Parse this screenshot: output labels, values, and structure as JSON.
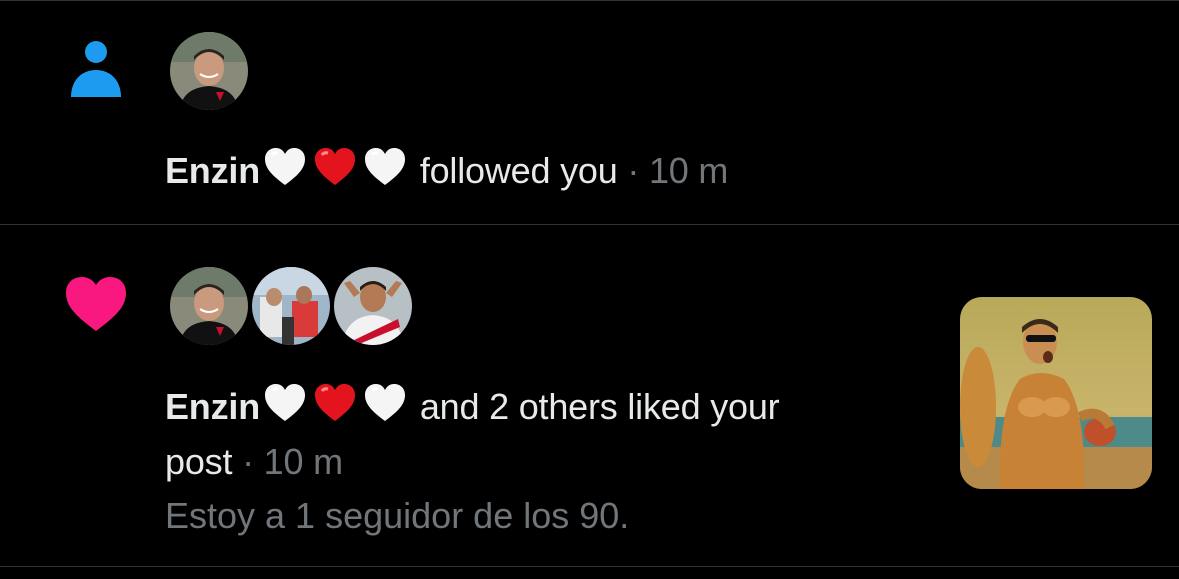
{
  "colors": {
    "background": "#000000",
    "text": "#e7e9ea",
    "muted": "#71767b",
    "follow_icon": "#1d9bf0",
    "like_icon": "#f91880",
    "divider": "#2f3336"
  },
  "notifications": [
    {
      "type_icon": "person-icon",
      "user_name": "Enzin",
      "name_emojis": [
        "white-heart",
        "red-heart",
        "white-heart"
      ],
      "action": "followed you",
      "separator": "·",
      "time": "10 m"
    },
    {
      "type_icon": "heart-icon",
      "user_name": "Enzin",
      "name_emojis": [
        "white-heart",
        "red-heart",
        "white-heart"
      ],
      "action_line1": "and 2 others liked your",
      "action_line2": "post",
      "separator": "·",
      "time": "10 m",
      "post_preview": "Estoy a 1 seguidor de los 90."
    }
  ]
}
